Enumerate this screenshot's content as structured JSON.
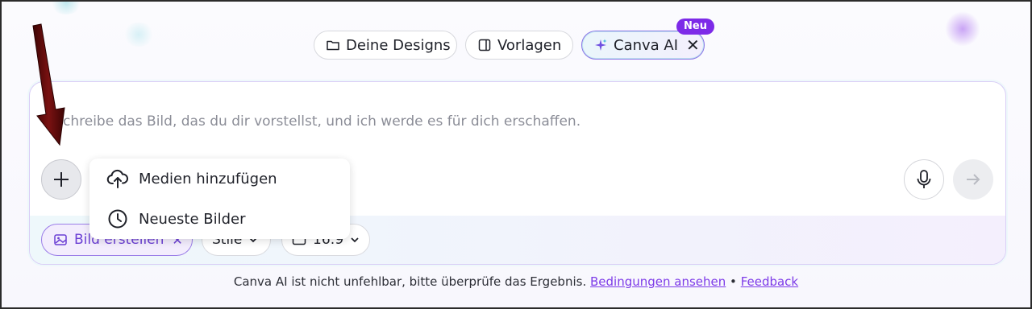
{
  "tabs": {
    "designs": "Deine Designs",
    "vorlagen": "Vorlagen",
    "canva_ai": "Canva AI",
    "new_badge": "Neu",
    "close_symbol": "✕"
  },
  "prompt": {
    "text": "chreibe das Bild, das du dir vorstellst, und ich werde es für dich erschaffen."
  },
  "chips": {
    "bild": "Bild erstellen",
    "stile": "Stile",
    "ratio": "16:9"
  },
  "menu": {
    "items": [
      {
        "label": "Medien hinzufügen",
        "icon": "cloud-upload-icon"
      },
      {
        "label": "Neueste Bilder",
        "icon": "clock-icon"
      }
    ]
  },
  "footer": {
    "text": "Canva AI ist nicht unfehlbar, bitte überprüfe das Ergebnis.",
    "terms_link": "Bedingungen ansehen",
    "separator": "•",
    "feedback_link": "Feedback"
  },
  "colors": {
    "accent": "#7d2ae8",
    "annotation_arrow": "#5a0a0a"
  }
}
